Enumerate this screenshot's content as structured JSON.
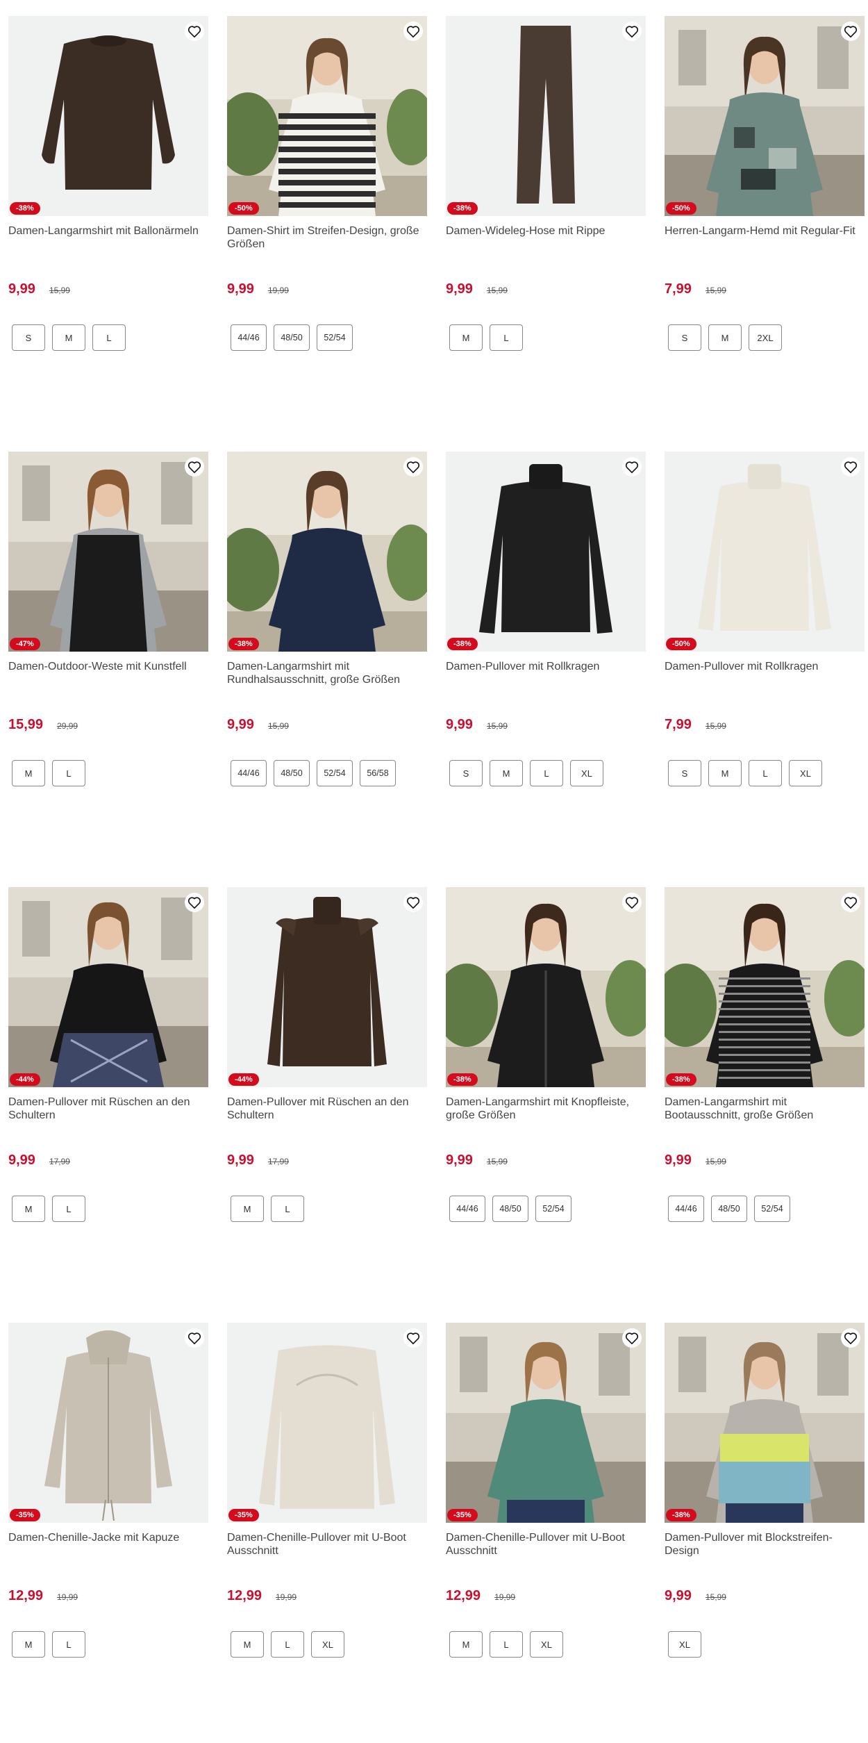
{
  "products": [
    {
      "title": "Damen-Langarmshirt mit Ballonärmeln",
      "price": "9,99",
      "old_price": "15,99",
      "discount": "-38%",
      "sizes": [
        "S",
        "M",
        "L"
      ],
      "art": "sweater-brown"
    },
    {
      "title": "Damen-Shirt im Streifen-Design, große Größen",
      "price": "9,99",
      "old_price": "19,99",
      "discount": "-50%",
      "sizes": [
        "44/46",
        "48/50",
        "52/54"
      ],
      "art": "model-stripes"
    },
    {
      "title": "Damen-Wideleg-Hose mit Rippe",
      "price": "9,99",
      "old_price": "15,99",
      "discount": "-38%",
      "sizes": [
        "M",
        "L"
      ],
      "art": "pants-brown"
    },
    {
      "title": "Herren-Langarm-Hemd mit Regular-Fit",
      "price": "7,99",
      "old_price": "15,99",
      "discount": "-50%",
      "sizes": [
        "S",
        "M",
        "2XL"
      ],
      "art": "model-shirt"
    },
    {
      "title": "Damen-Outdoor-Weste mit Kunstfell",
      "price": "15,99",
      "old_price": "29,99",
      "discount": "-47%",
      "sizes": [
        "M",
        "L"
      ],
      "art": "model-vest"
    },
    {
      "title": "Damen-Langarmshirt mit Rundhalsausschnitt, große Größen",
      "price": "9,99",
      "old_price": "15,99",
      "discount": "-38%",
      "sizes": [
        "44/46",
        "48/50",
        "52/54",
        "56/58"
      ],
      "art": "model-navy"
    },
    {
      "title": "Damen-Pullover mit Rollkragen",
      "price": "9,99",
      "old_price": "15,99",
      "discount": "-38%",
      "sizes": [
        "S",
        "M",
        "L",
        "XL"
      ],
      "art": "sweater-black"
    },
    {
      "title": "Damen-Pullover mit Rollkragen",
      "price": "7,99",
      "old_price": "15,99",
      "discount": "-50%",
      "sizes": [
        "S",
        "M",
        "L",
        "XL"
      ],
      "art": "sweater-cream"
    },
    {
      "title": "Damen-Pullover mit Rüschen an den Schultern",
      "price": "9,99",
      "old_price": "17,99",
      "discount": "-44%",
      "sizes": [
        "M",
        "L"
      ],
      "art": "model-black-skirt"
    },
    {
      "title": "Damen-Pullover mit Rüschen an den Schultern",
      "price": "9,99",
      "old_price": "17,99",
      "discount": "-44%",
      "sizes": [
        "M",
        "L"
      ],
      "art": "sweater-brown-ruffle"
    },
    {
      "title": "Damen-Langarmshirt mit Knopfleiste, große Größen",
      "price": "9,99",
      "old_price": "15,99",
      "discount": "-38%",
      "sizes": [
        "44/46",
        "48/50",
        "52/54"
      ],
      "art": "model-black-button"
    },
    {
      "title": "Damen-Langarmshirt mit Bootausschnitt, große Größen",
      "price": "9,99",
      "old_price": "15,99",
      "discount": "-38%",
      "sizes": [
        "44/46",
        "48/50",
        "52/54"
      ],
      "art": "model-black-stripes"
    },
    {
      "title": "Damen-Chenille-Jacke mit Kapuze",
      "price": "12,99",
      "old_price": "19,99",
      "discount": "-35%",
      "sizes": [
        "M",
        "L"
      ],
      "art": "jacket-beige"
    },
    {
      "title": "Damen-Chenille-Pullover mit U-Boot Ausschnitt",
      "price": "12,99",
      "old_price": "19,99",
      "discount": "-35%",
      "sizes": [
        "M",
        "L",
        "XL"
      ],
      "art": "sweater-beige"
    },
    {
      "title": "Damen-Chenille-Pullover mit U-Boot Ausschnitt",
      "price": "12,99",
      "old_price": "19,99",
      "discount": "-35%",
      "sizes": [
        "M",
        "L",
        "XL"
      ],
      "art": "model-green"
    },
    {
      "title": "Damen-Pullover mit Blockstreifen-Design",
      "price": "9,99",
      "old_price": "15,99",
      "discount": "-38%",
      "sizes": [
        "XL"
      ],
      "art": "model-blockstripe"
    }
  ],
  "colors": {
    "accent": "#c8102e",
    "badge": "#d40b1d"
  },
  "icons": {
    "favorite": "heart-outline-icon"
  }
}
